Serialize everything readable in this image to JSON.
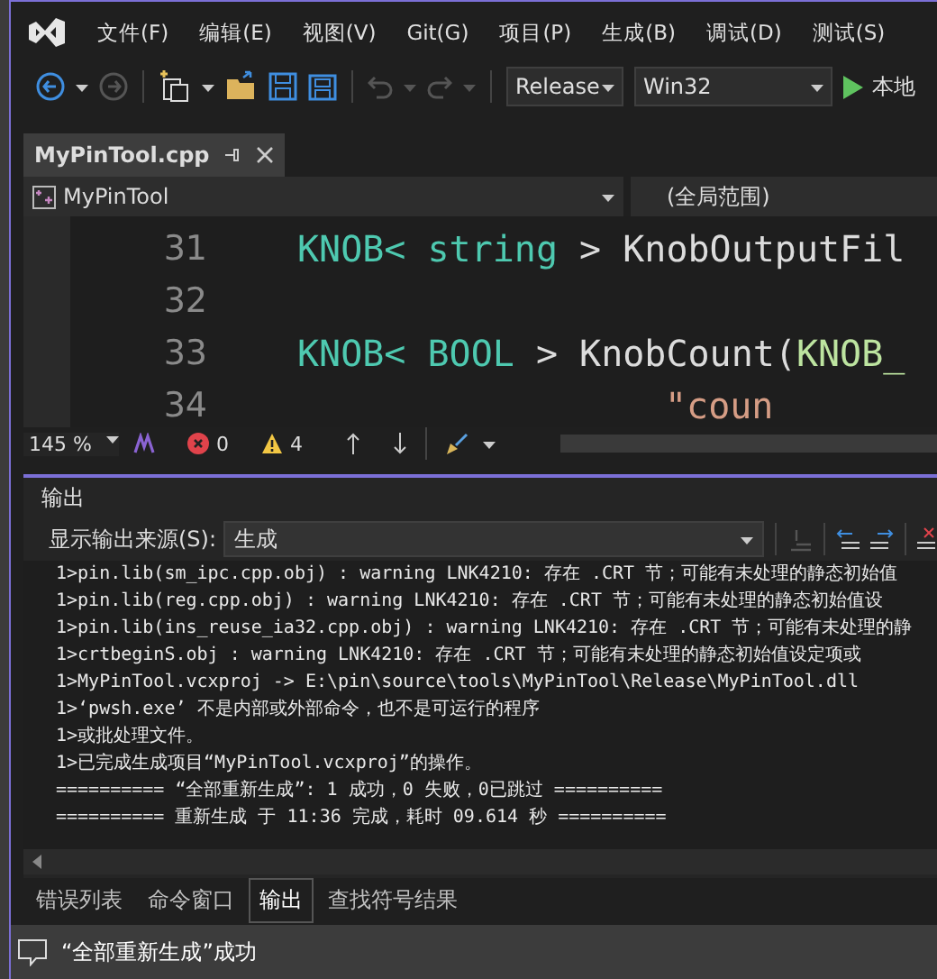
{
  "menu": [
    "文件(F)",
    "编辑(E)",
    "视图(V)",
    "Git(G)",
    "项目(P)",
    "生成(B)",
    "调试(D)",
    "测试(S)"
  ],
  "toolbar": {
    "configuration": "Release",
    "platform": "Win32",
    "run_label": "本地"
  },
  "document_tabs": [
    {
      "label": "MyPinTool.cpp",
      "selected": true
    }
  ],
  "navigation": {
    "project": "MyPinTool",
    "scope": "(全局范围)"
  },
  "code_lines": [
    {
      "number": "31",
      "tokens": [
        {
          "text": "KNOB< ",
          "kind": "type"
        },
        {
          "text": "string",
          "kind": "type"
        },
        {
          "text": " > KnobOutputFil",
          "kind": "plain"
        }
      ]
    },
    {
      "number": "32"
    },
    {
      "number": "33",
      "tokens": [
        {
          "text": "KNOB< ",
          "kind": "type"
        },
        {
          "text": "BOOL",
          "kind": "type"
        },
        {
          "text": " > KnobCount(",
          "kind": "plain"
        },
        {
          "text": "KNOB_",
          "kind": "macro"
        }
      ]
    },
    {
      "number": "34",
      "kind": "continuation",
      "tokens": [
        {
          "text": "\"coun",
          "kind": "string"
        }
      ]
    }
  ],
  "editor_status": {
    "zoom": "145 %",
    "errors": "0",
    "warnings": "4"
  },
  "output_panel": {
    "title": "输出",
    "source_label": "显示输出来源(S):",
    "source": "生成",
    "lines": [
      "1>pin.lib(sm_ipc.cpp.obj) : warning LNK4210: 存在 .CRT 节；可能有未处理的静态初始值",
      "1>pin.lib(reg.cpp.obj) : warning LNK4210: 存在 .CRT 节；可能有未处理的静态初始值设",
      "1>pin.lib(ins_reuse_ia32.cpp.obj) : warning LNK4210: 存在 .CRT 节；可能有未处理的静",
      "1>crtbeginS.obj : warning LNK4210: 存在 .CRT 节；可能有未处理的静态初始值设定项或",
      "1>MyPinTool.vcxproj -> E:\\pin\\source\\tools\\MyPinTool\\Release\\MyPinTool.dll",
      "1>‘pwsh.exe’ 不是内部或外部命令，也不是可运行的程序",
      "1>或批处理文件。",
      "1>已完成生成项目“MyPinTool.vcxproj”的操作。",
      "========== “全部重新生成”: 1 成功，0 失败，0已跳过 ==========",
      "========== 重新生成 于 11:36 完成，耗时 09.614 秒 =========="
    ]
  },
  "bottom_tabs": [
    {
      "label": "错误列表",
      "selected": false
    },
    {
      "label": "命令窗口",
      "selected": false
    },
    {
      "label": "输出",
      "selected": true
    },
    {
      "label": "查找符号结果",
      "selected": false
    }
  ],
  "status_bar": {
    "message": "“全部重新生成”成功"
  }
}
